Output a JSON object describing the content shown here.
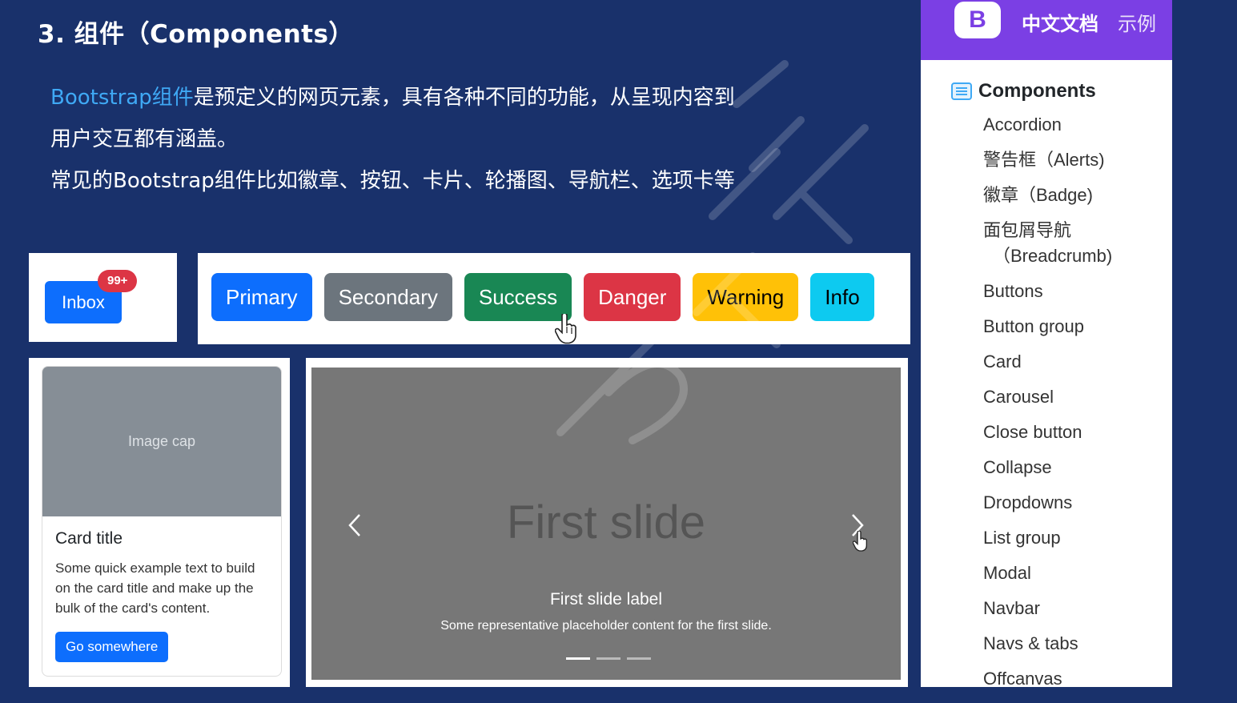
{
  "slide": {
    "title": "3. 组件（Components）",
    "intro_highlight": "Bootstrap组件",
    "intro_line1_rest": "是预定义的网页元素，具有各种不同的功能，从呈现内容到",
    "intro_line2": "用户交互都有涵盖。",
    "intro_line3": "常见的Bootstrap组件比如徽章、按钮、卡片、轮播图、导航栏、选项卡等"
  },
  "badge_demo": {
    "button_label": "Inbox",
    "badge_count": "99+"
  },
  "buttons_demo": {
    "buttons": [
      {
        "label": "Primary",
        "color": "#0d6efd",
        "text_color": "#ffffff"
      },
      {
        "label": "Secondary",
        "color": "#6c757d",
        "text_color": "#ffffff"
      },
      {
        "label": "Success",
        "color": "#198754",
        "text_color": "#ffffff"
      },
      {
        "label": "Danger",
        "color": "#dc3545",
        "text_color": "#ffffff"
      },
      {
        "label": "Warning",
        "color": "#ffc107",
        "text_color": "#000000"
      },
      {
        "label": "Info",
        "color": "#0dcaf0",
        "text_color": "#000000"
      }
    ]
  },
  "card_demo": {
    "image_cap": "Image cap",
    "title": "Card title",
    "text": "Some quick example text to build on the card title and make up the bulk of the card's content.",
    "button_label": "Go somewhere"
  },
  "carousel_demo": {
    "slide_text": "First slide",
    "caption_title": "First slide label",
    "caption_text": "Some representative placeholder content for the first slide.",
    "indicator_count": 3,
    "active_index": 0
  },
  "sidebar": {
    "logo": "B",
    "doc_label": "中文文档",
    "examples_label": "示例",
    "section_title": "Components",
    "items": [
      {
        "label": "Accordion"
      },
      {
        "label": "警告框（Alerts)"
      },
      {
        "label": "徽章（Badge)"
      },
      {
        "label": "面包屑导航",
        "sub": "（Breadcrumb)"
      },
      {
        "label": "Buttons"
      },
      {
        "label": "Button group"
      },
      {
        "label": "Card"
      },
      {
        "label": "Carousel"
      },
      {
        "label": "Close button"
      },
      {
        "label": "Collapse"
      },
      {
        "label": "Dropdowns"
      },
      {
        "label": "List group"
      },
      {
        "label": "Modal"
      },
      {
        "label": "Navbar"
      },
      {
        "label": "Navs & tabs"
      },
      {
        "label": "Offcanvas"
      }
    ]
  },
  "colors": {
    "background": "#19316b",
    "highlight": "#3fa9f5",
    "sidebar_header": "#7b3fe4"
  }
}
